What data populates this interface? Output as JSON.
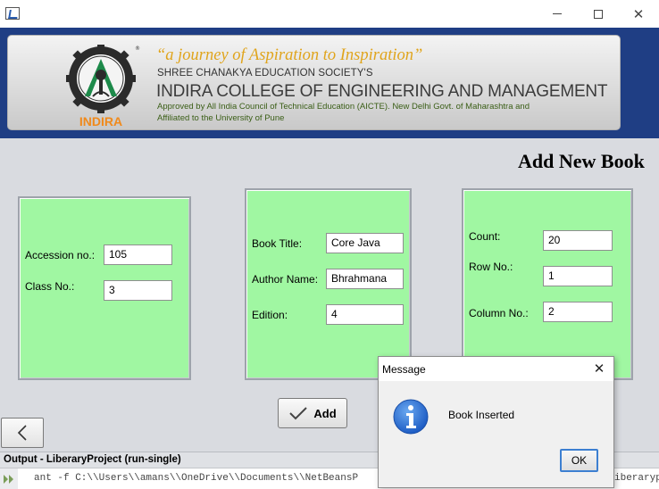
{
  "window": {
    "icon": "java-app-icon",
    "controls": {
      "minimize": "minimize-icon",
      "maximize": "maximize-icon",
      "close": "✕"
    }
  },
  "banner": {
    "logo_text": "INDIRA",
    "logo_ring_text": "SHREE CHANAKYA EDUCATION SOCIETY",
    "tagline": "“a journey of Aspiration to Inspiration”",
    "society": "SHREE CHANAKYA EDUCATION SOCIETY'S",
    "college": "INDIRA COLLEGE OF ENGINEERING AND MANAGEMENT",
    "approved_line1": "Approved by All India Council of Technical Education (AICTE). New Delhi Govt. of Maharashtra and",
    "approved_line2": "Affiliated to the University of Pune",
    "colors": {
      "banner_bg": "#1f3e84",
      "tagline": "#e0a41b",
      "logo_green": "#1d8a4a",
      "logo_orange": "#f08a1c"
    }
  },
  "page": {
    "title": "Add New Book",
    "panel_color": "#a0f7a2"
  },
  "form": {
    "accession": {
      "label": "Accession no.:",
      "value": "105"
    },
    "class_no": {
      "label": "Class No.:",
      "value": "3"
    },
    "book_title": {
      "label": "Book Title:",
      "value": "Core Java"
    },
    "author": {
      "label": "Author Name:",
      "value": "Bhrahmana"
    },
    "edition": {
      "label": "Edition:",
      "value": "4"
    },
    "count": {
      "label": "Count:",
      "value": "20"
    },
    "row_no": {
      "label": "Row No.:",
      "value": "1"
    },
    "column_no": {
      "label": "Column No.:",
      "value": "2"
    }
  },
  "buttons": {
    "add": "Add",
    "add_icon": "checkmark-icon",
    "back_icon": "chevron-left-icon"
  },
  "output": {
    "title": "Output - LiberaryProject (run-single)",
    "line": "ant -f C:\\\\Users\\\\amans\\\\OneDrive\\\\Documents\\\\NetBeansP",
    "line_tail": "iberaryproj"
  },
  "dialog": {
    "title": "Message",
    "close": "✕",
    "message": "Book Inserted",
    "ok": "OK",
    "icon": "info-icon"
  }
}
